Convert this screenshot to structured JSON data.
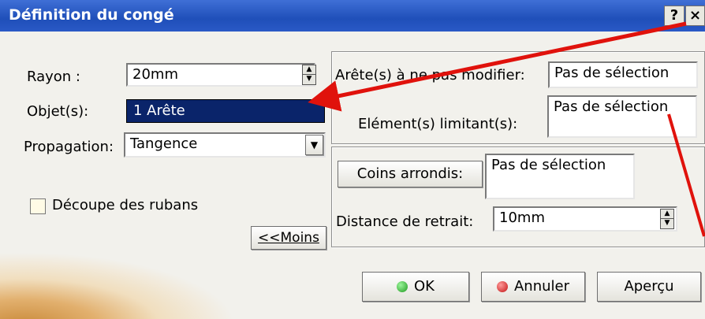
{
  "dialog": {
    "title": "Définition du congé",
    "help_glyph": "?",
    "close_glyph": "×"
  },
  "left": {
    "rayon_label": "Rayon :",
    "rayon_value": "20mm",
    "objets_label": "Objet(s):",
    "objets_value": "1 Arête",
    "propagation_label": "Propagation:",
    "propagation_value": "Tangence",
    "decoupe_label": "Découpe des rubans",
    "decoupe_checked": false,
    "moins_button": "<<Moins"
  },
  "right": {
    "aretes_label": "Arête(s) à ne pas modifier:",
    "aretes_value": "Pas de sélection",
    "elements_label": "Elément(s) limitant(s):",
    "elements_value": "Pas de sélection",
    "coins_button": "Coins arrondis:",
    "coins_value": "Pas de sélection",
    "distance_label": "Distance de retrait:",
    "distance_value": "10mm"
  },
  "footer": {
    "ok_label": "OK",
    "annuler_label": "Annuler",
    "apercu_label": "Aperçu"
  },
  "icons": {
    "ok": "green-dot-icon",
    "annuler": "red-dot-icon"
  },
  "colors": {
    "title_bar": "#2a59c6",
    "selection": "#0a246a",
    "annotation_arrow": "#e0120c"
  }
}
